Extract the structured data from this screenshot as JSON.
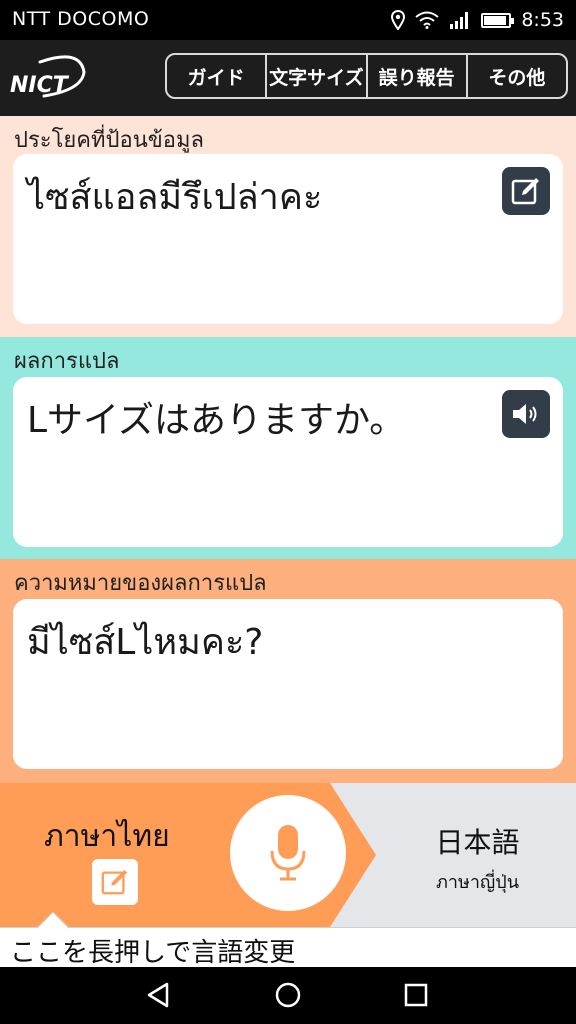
{
  "status": {
    "carrier": "NTT DOCOMO",
    "time": "8:53",
    "battery_level": 0.85,
    "icons": [
      "location-icon",
      "wifi-icon",
      "signal-icon",
      "battery-icon"
    ]
  },
  "header": {
    "logo": "NICT",
    "menu": [
      "ガイド",
      "文字サイズ",
      "誤り報告",
      "その他"
    ]
  },
  "input_section": {
    "label": "ประโยคที่ป้อนข้อมูล",
    "text": "ไซส์แอลมีรึเปล่าคะ",
    "icon": "edit-icon",
    "color": "#fde4d6"
  },
  "translation_section": {
    "label": "ผลการแปล",
    "text": "Lサイズはありますか。",
    "icon": "speaker-icon",
    "color": "#95e8de"
  },
  "backtranslation_section": {
    "label": "ความหมายของผลการแปล",
    "text": "มีไซส์Lไหมคะ?",
    "color": "#fdb07e"
  },
  "language_bar": {
    "source_language": "ภาษาไทย",
    "target_language": "日本語",
    "target_language_sub": "ภาษาญี่ปุ่น",
    "accent": "#ff9d57",
    "icons": [
      "edit-icon",
      "microphone-icon"
    ]
  },
  "hint": {
    "text": "ここを長押しで言語変更"
  },
  "navigation": {
    "icons": [
      "back-icon",
      "home-icon",
      "recents-icon"
    ]
  }
}
